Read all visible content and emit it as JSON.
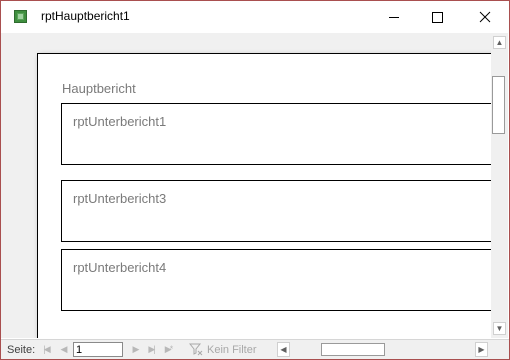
{
  "window": {
    "title": "rptHauptbericht1",
    "icon": "access-report-icon"
  },
  "report": {
    "title": "Hauptbericht",
    "subreports": [
      {
        "label": "rptUnterbericht1"
      },
      {
        "label": "rptUnterbericht3"
      },
      {
        "label": "rptUnterbericht4"
      }
    ]
  },
  "navigation": {
    "page_label": "Seite:",
    "page_value": "1",
    "filter_label": "Kein Filter"
  }
}
